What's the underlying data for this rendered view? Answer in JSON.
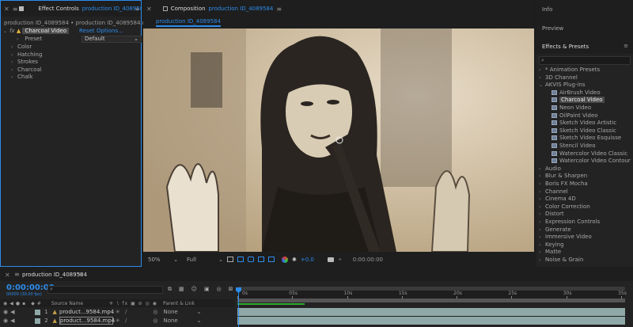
{
  "effect_controls": {
    "title": "Effect Controls",
    "file_label": "production ID_4089584.mp4",
    "breadcrumb": "production ID_4089584 • production ID_4089584.mp4",
    "effect_name": "Charcoal Video",
    "reset": "Reset",
    "options": "Options...",
    "preset_label": "Preset",
    "preset_value": "Default",
    "groups": [
      "Color",
      "Hatching",
      "Strokes",
      "Charcoal",
      "Chalk"
    ]
  },
  "composition": {
    "title": "Composition",
    "name": "production ID_4089584",
    "tab_label": "production ID_4089584",
    "zoom": "50%",
    "resolution": "Full",
    "exposure": "+0.0",
    "timecode": "0:00:00:00"
  },
  "right": {
    "info": "Info",
    "preview": "Preview",
    "effects_presets": "Effects & Presets",
    "search_placeholder": "",
    "categories_top": [
      "* Animation Presets",
      "3D Channel",
      "AKVIS Plug-ins"
    ],
    "akvis_items": [
      "AirBrush Video",
      "Charcoal Video",
      "Neon Video",
      "OilPaint Video",
      "Sketch Video Artistic",
      "Sketch Video Classic",
      "Sketch Video Esquisse",
      "Stencil Video",
      "Watercolor Video Classic",
      "Watercolor Video Contour"
    ],
    "categories_bottom": [
      "Audio",
      "Blur & Sharpen",
      "Boris FX Mocha",
      "Channel",
      "Cinema 4D",
      "Color Correction",
      "Distort",
      "Expression Controls",
      "Generate",
      "Immersive Video",
      "Keying",
      "Matte",
      "Noise & Grain"
    ]
  },
  "timeline": {
    "tab_label": "production ID_4089584",
    "timecode": "0:00:00:00",
    "fps": "00000 (30.00 fps)",
    "col_source": "Source Name",
    "col_parent": "Parent & Link",
    "ruler": [
      "0s",
      "05s",
      "10s",
      "15s",
      "20s",
      "25s",
      "30s",
      "35s"
    ],
    "layers": [
      {
        "num": "1",
        "name": "product...9584.mp4",
        "parent": "None"
      },
      {
        "num": "2",
        "name": "product...9584.mp4",
        "parent": "None"
      }
    ]
  },
  "colors": {
    "accent": "#2d8ceb",
    "panel": "#232323",
    "header": "#1e1e1e",
    "track": "#8fa9a8",
    "label": "#c8a14a"
  }
}
